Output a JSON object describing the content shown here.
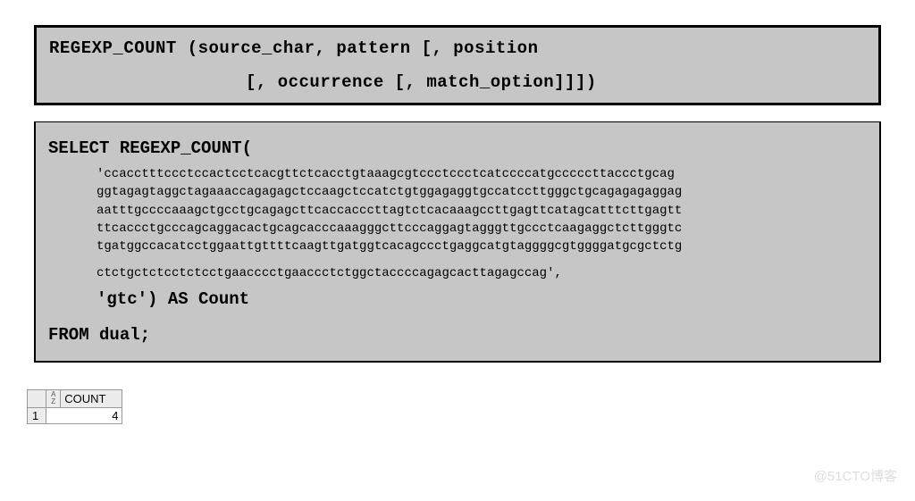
{
  "syntax": {
    "line1": "REGEXP_COUNT (source_char, pattern [, position",
    "line2": "[, occurrence [, match_option]]])"
  },
  "query": {
    "select": "SELECT REGEXP_COUNT(",
    "seq1": "'ccacctttccctccactcctcacgttctcacctgtaaagcgtccctccctcatccccatgcccccttaccctgcag",
    "seq2": "ggtagagtaggctagaaaccagagagctccaagctccatctgtggagaggtgccatccttgggctgcagagagaggag",
    "seq3": "aatttgccccaaagctgcctgcagagcttcaccacccttagtctcacaaagccttgagttcatagcatttcttgagtt",
    "seq4": "ttcaccctgcccagcaggacactgcagcacccaaagggcttcccaggagtagggttgccctcaagaggctcttgggtc",
    "seq5": "tgatggccacatcctggaattgttttcaagttgatggtcacagccctgaggcatgtaggggcgtggggatgcgctctg",
    "seq6": "ctctgctctcctctcctgaacccctgaaccctctggctaccccagagcacttagagccag',",
    "pattern": "'gtc') AS Count",
    "from": "FROM dual;"
  },
  "result": {
    "column_header": "COUNT",
    "row_number": "1",
    "value": "4"
  },
  "watermark": "@51CTO博客"
}
